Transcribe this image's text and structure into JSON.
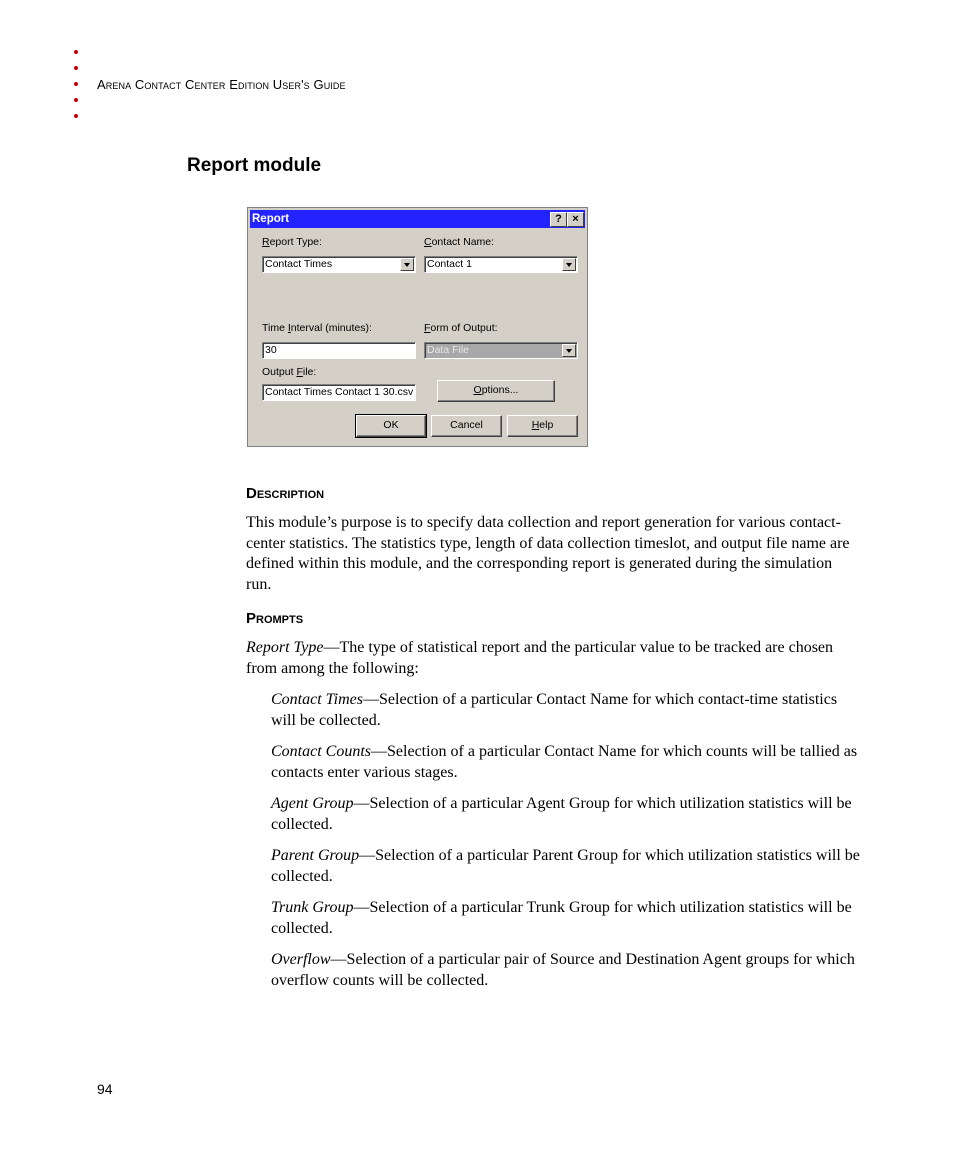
{
  "header": {
    "running_head": "Arena Contact Center Edition User's Guide",
    "bullet_color": "#c00000"
  },
  "section_title": "Report module",
  "dialog": {
    "title": "Report",
    "help_button": "?",
    "close_button": "×",
    "report_type": {
      "label_prefix": "",
      "label_accel": "R",
      "label_rest": "eport Type:",
      "value": "Contact Times"
    },
    "contact_name": {
      "label_accel": "C",
      "label_rest": "ontact Name:",
      "value": "Contact 1"
    },
    "time_interval": {
      "label_prefix": "Time ",
      "label_accel": "I",
      "label_rest": "nterval (minutes):",
      "value": "30"
    },
    "form_of_output": {
      "label_accel": "F",
      "label_rest": "orm of Output:",
      "value": "Data File"
    },
    "output_file": {
      "label_prefix": "Output ",
      "label_accel": "F",
      "label_rest": "ile:",
      "value": "Contact Times Contact 1 30.csv"
    },
    "options_button": {
      "accel": "O",
      "rest": "ptions..."
    },
    "ok_button": "OK",
    "cancel_button": "Cancel",
    "help_btn": {
      "accel": "H",
      "rest": "elp"
    },
    "title_color": "#2323ff"
  },
  "description": {
    "heading": "Description",
    "text": "This module’s purpose is to specify data collection and report generation for various contact-center statistics. The statistics type, length of data collection timeslot, and output file name are defined within this module, and the corresponding report is generated during the simulation run."
  },
  "prompts": {
    "heading": "Prompts",
    "intro_term": "Report Type",
    "intro_text": "—The type of statistical report and the particular value to be tracked are chosen from among the following:",
    "items": [
      {
        "term": "Contact Times",
        "text": "—Selection of a particular Contact Name for which contact-time statistics will be collected."
      },
      {
        "term": "Contact Counts",
        "text": "—Selection of a particular Contact Name for which counts will be tallied as contacts enter various stages."
      },
      {
        "term": "Agent Group",
        "text": "—Selection of a particular Agent Group for which utilization statistics will be collected."
      },
      {
        "term": "Parent Group",
        "text": "—Selection of a particular Parent Group for which utilization statistics will be collected."
      },
      {
        "term": "Trunk Group",
        "text": "—Selection of a particular Trunk Group for which utilization statistics will be collected."
      },
      {
        "term": "Overflow",
        "text": "—Selection of a particular pair of Source and Destination Agent groups for which overflow counts will be collected."
      }
    ]
  },
  "page_number": "94"
}
